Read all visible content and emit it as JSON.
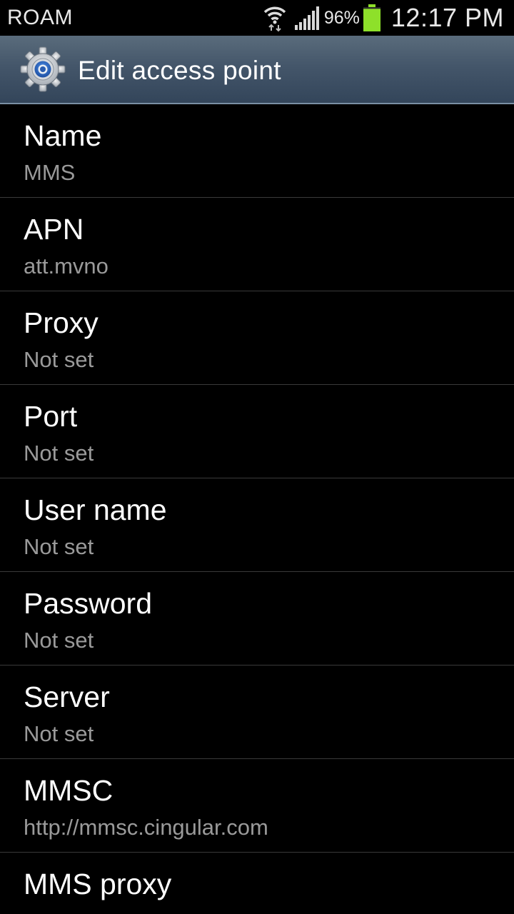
{
  "status_bar": {
    "carrier_label": "ROAM",
    "battery_percent": "96%",
    "battery_level": 0.96,
    "time": "12:17 PM",
    "icons": [
      "wifi-icon",
      "signal-icon",
      "battery-icon"
    ],
    "colors": {
      "battery_fill": "#8ee02a",
      "text": "#e8e8e8"
    }
  },
  "action_bar": {
    "icon": "settings-gear-icon",
    "title": "Edit access point"
  },
  "settings": [
    {
      "title": "Name",
      "value": "MMS"
    },
    {
      "title": "APN",
      "value": "att.mvno"
    },
    {
      "title": "Proxy",
      "value": "Not set"
    },
    {
      "title": "Port",
      "value": "Not set"
    },
    {
      "title": "User name",
      "value": "Not set"
    },
    {
      "title": "Password",
      "value": "Not set"
    },
    {
      "title": "Server",
      "value": "Not set"
    },
    {
      "title": "MMSC",
      "value": "http://mmsc.cingular.com"
    },
    {
      "title": "MMS proxy",
      "value": ""
    }
  ],
  "colors": {
    "background": "#000000",
    "action_bar": "#44566a",
    "divider": "#3a3a3a",
    "secondary_text": "#9a9a9a"
  }
}
